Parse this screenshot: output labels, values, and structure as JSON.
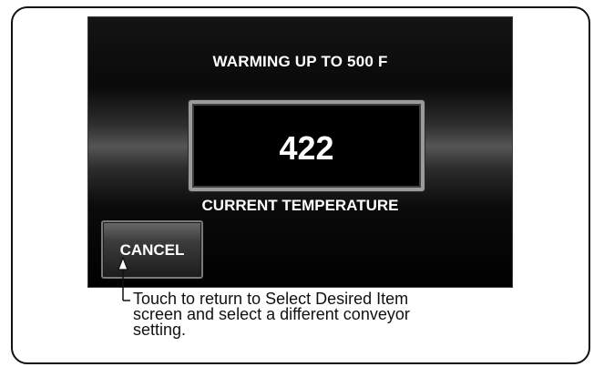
{
  "screen": {
    "title": "WARMING UP TO 500 F",
    "temperature_value": "422",
    "temperature_label": "CURRENT TEMPERATURE",
    "cancel_label": "CANCEL"
  },
  "callout": {
    "lines": [
      "Touch to return to Select Desired Item",
      "screen and select a different conveyor",
      "setting."
    ]
  }
}
